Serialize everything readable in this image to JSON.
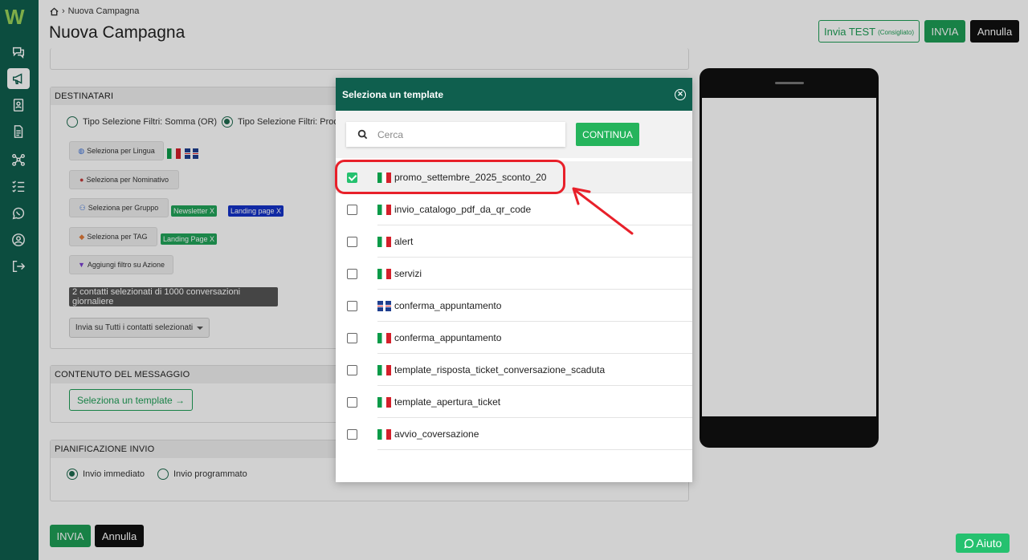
{
  "app": {
    "logo_text": "W"
  },
  "sidebar": {
    "items": [
      {
        "name": "chat",
        "icon": "chat-bubbles-icon"
      },
      {
        "name": "campaigns",
        "icon": "megaphone-icon",
        "active": true
      },
      {
        "name": "contacts",
        "icon": "contact-book-icon"
      },
      {
        "name": "templates",
        "icon": "document-icon"
      },
      {
        "name": "flows",
        "icon": "network-icon"
      },
      {
        "name": "tasks",
        "icon": "checklist-icon"
      },
      {
        "name": "whatsapp",
        "icon": "whatsapp-icon"
      },
      {
        "name": "profile",
        "icon": "user-circle-icon"
      },
      {
        "name": "logout",
        "icon": "logout-icon"
      }
    ]
  },
  "header": {
    "breadcrumb": "Nuova Campagna",
    "title": "Nuova Campagna",
    "test_label": "Invia TEST",
    "test_hint": "(Consigliato)",
    "send_label": "INVIA",
    "cancel_label": "Annulla"
  },
  "recipients": {
    "heading": "DESTINATARI",
    "filter_type_sum": "Tipo Selezione Filtri: Somma (OR)",
    "filter_type_product": "Tipo Selezione Filtri: Prodo",
    "by_language": "Seleziona per Lingua",
    "by_name": "Seleziona per Nominativo",
    "by_group": "Seleziona per Gruppo",
    "group_tags": [
      "Newsletter X",
      "Landing page X"
    ],
    "by_tag": "Seleziona per TAG",
    "tag_tags": [
      "Landing Page X"
    ],
    "by_action": "Aggiungi filtro su Azione",
    "count_text": "2 contatti selezionati di 1000 conversazioni giornaliere",
    "send_to": "Invia su Tutti i contatti selezionati"
  },
  "message": {
    "heading": "CONTENUTO DEL MESSAGGIO",
    "select_template": "Seleziona un template →"
  },
  "schedule": {
    "heading": "PIANIFICAZIONE INVIO",
    "immediate": "Invio immediato",
    "scheduled": "Invio programmato"
  },
  "footer": {
    "send_label": "INVIA",
    "cancel_label": "Annulla"
  },
  "help": {
    "label": "Aiuto"
  },
  "modal": {
    "title": "Seleziona un template",
    "search_placeholder": "Cerca",
    "continue_label": "CONTINUA",
    "templates": [
      {
        "name": "promo_settembre_2025_sconto_20",
        "lang": "it",
        "checked": true
      },
      {
        "name": "invio_catalogo_pdf_da_qr_code",
        "lang": "it",
        "checked": false
      },
      {
        "name": "alert",
        "lang": "it",
        "checked": false
      },
      {
        "name": "servizi",
        "lang": "it",
        "checked": false
      },
      {
        "name": "conferma_appuntamento",
        "lang": "en",
        "checked": false
      },
      {
        "name": "conferma_appuntamento",
        "lang": "it",
        "checked": false
      },
      {
        "name": "template_risposta_ticket_conversazione_scaduta",
        "lang": "it",
        "checked": false
      },
      {
        "name": "template_apertura_ticket",
        "lang": "it",
        "checked": false
      },
      {
        "name": "avvio_coversazione",
        "lang": "it",
        "checked": false
      }
    ]
  },
  "colors": {
    "brand": "#0f5f4e",
    "accent": "#1e9e56",
    "highlight": "#e8202a"
  }
}
